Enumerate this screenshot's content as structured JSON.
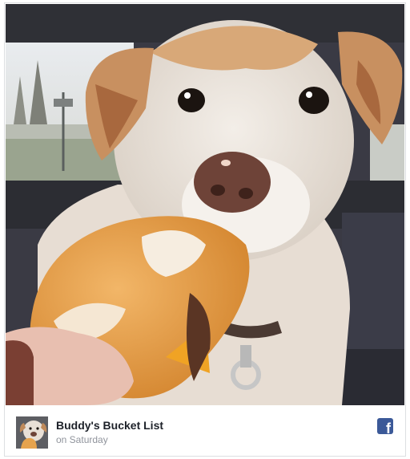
{
  "post": {
    "image_description_icon": "dog-eating-cheeseburger-photo",
    "page_name": "Buddy's Bucket List",
    "timestamp": "on Saturday",
    "platform_icon": "facebook-icon",
    "facebook_glyph": "f"
  },
  "colors": {
    "facebook_blue": "#3b5998",
    "title_text": "#1d2129",
    "meta_text": "#90949c"
  }
}
